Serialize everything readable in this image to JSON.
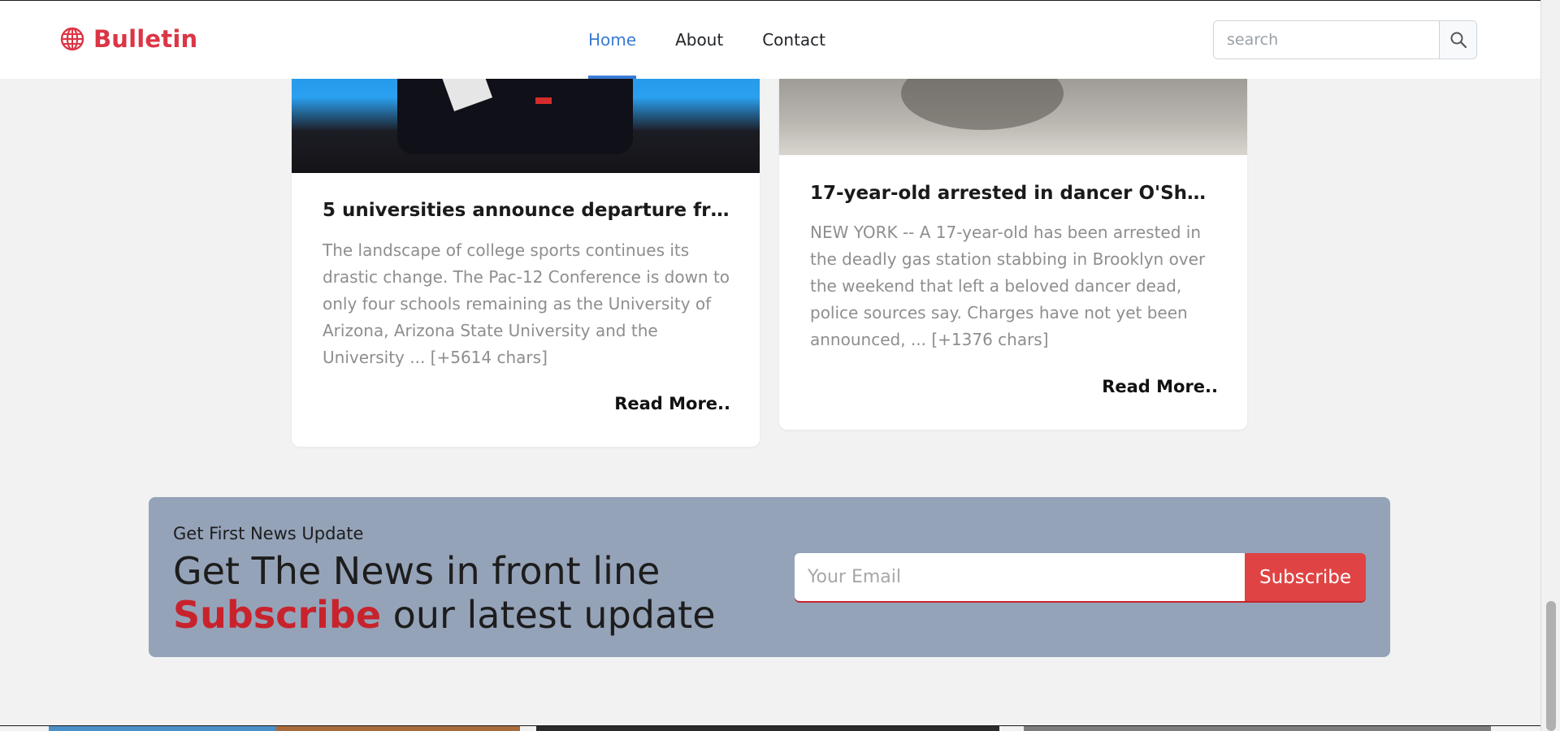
{
  "brand": {
    "name": "Bulletin",
    "color": "#dc3545"
  },
  "nav": {
    "items": [
      {
        "label": "Home",
        "active": true
      },
      {
        "label": "About",
        "active": false
      },
      {
        "label": "Contact",
        "active": false
      }
    ]
  },
  "search": {
    "placeholder": "search",
    "icon": "search-icon"
  },
  "cards": [
    {
      "title": "5 universities announce departure from Pac...",
      "description": "The landscape of college sports continues its drastic change. The Pac-12 Conference is down to only four schools remaining as the University of Arizona, Arizona State University and the University ... [+5614 chars]",
      "read_more": "Read More.."
    },
    {
      "title": "17-year-old arrested in dancer O'Shae Sibley...",
      "description": "NEW YORK -- A 17-year-old has been arrested in the deadly gas station stabbing in Brooklyn over the weekend that left a beloved dancer dead, police sources say. Charges have not yet been announced, ... [+1376 chars]",
      "read_more": "Read More.."
    }
  ],
  "newsletter": {
    "kicker": "Get First News Update",
    "headline_line1": "Get The News in front line",
    "headline_accent": "Subscribe",
    "headline_line2_rest": " our latest update",
    "email_placeholder": "Your Email",
    "button_label": "Subscribe",
    "bg_color": "#95a3b9",
    "accent_color": "#c8232c",
    "button_color": "#e04343"
  }
}
